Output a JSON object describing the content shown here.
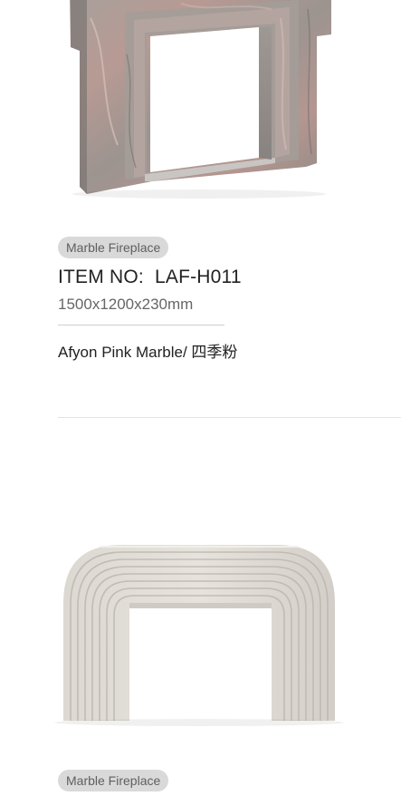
{
  "products": [
    {
      "category_badge": "Marble Fireplace",
      "item_no": "ITEM NO:  LAF-H011",
      "dimensions": "1500x1200x230mm",
      "material": "Afyon Pink Marble/ 四季粉"
    },
    {
      "category_badge": "Marble Fireplace"
    }
  ]
}
